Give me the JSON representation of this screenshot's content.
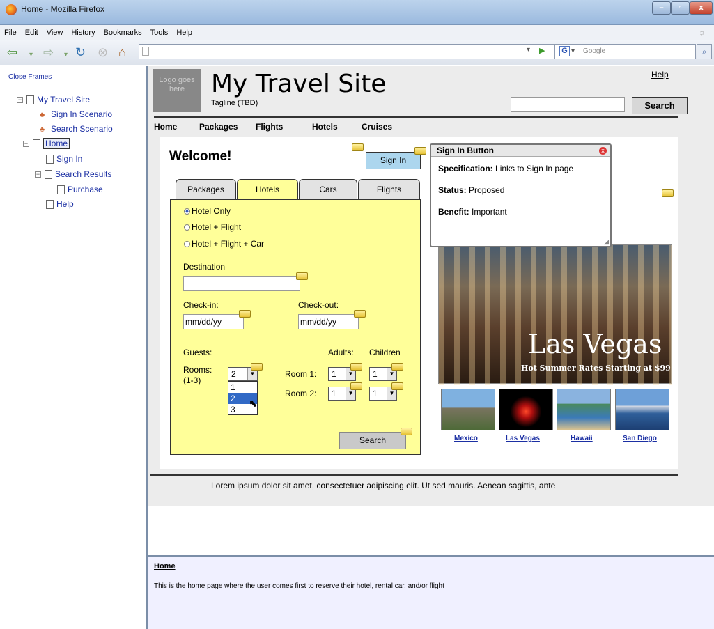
{
  "window": {
    "title": "Home - Mozilla Firefox"
  },
  "menu": [
    "File",
    "Edit",
    "View",
    "History",
    "Bookmarks",
    "Tools",
    "Help"
  ],
  "toolbar": {
    "search_placeholder": "Google"
  },
  "sidebar": {
    "close_frames": "Close Frames",
    "tree": [
      {
        "label": "My Travel Site",
        "type": "page",
        "toggle": "⊟"
      },
      {
        "label": "Sign In Scenario",
        "type": "scenario"
      },
      {
        "label": "Search Scenario",
        "type": "scenario"
      },
      {
        "label": "Home",
        "type": "page",
        "toggle": "⊟",
        "selected": true
      },
      {
        "label": "Sign In",
        "type": "page"
      },
      {
        "label": "Search Results",
        "type": "page",
        "toggle": "⊟"
      },
      {
        "label": "Purchase",
        "type": "page"
      },
      {
        "label": "Help",
        "type": "page"
      }
    ]
  },
  "header": {
    "logo": "Logo goes here",
    "site_title": "My Travel Site",
    "tagline": "Tagline (TBD)",
    "help": "Help",
    "search_button": "Search"
  },
  "nav": [
    "Home",
    "Packages",
    "Flights",
    "Hotels",
    "Cruises"
  ],
  "welcome": "Welcome!",
  "sign_in": "Sign In",
  "tabs": [
    "Packages",
    "Hotels",
    "Cars",
    "Flights"
  ],
  "active_tab": "Hotels",
  "booking": {
    "options": [
      "Hotel Only",
      "Hotel + Flight",
      "Hotel + Flight + Car"
    ],
    "selected_option": "Hotel Only",
    "destination_label": "Destination",
    "checkin_label": "Check-in:",
    "checkout_label": "Check-out:",
    "date_value": "mm/dd/yy",
    "guests_label": "Guests:",
    "adults_label": "Adults:",
    "children_label": "Children",
    "rooms_label": "Rooms:",
    "rooms_range": "(1-3)",
    "rooms_value": "2",
    "rooms_options": [
      "1",
      "2",
      "3"
    ],
    "room1_label": "Room 1:",
    "room2_label": "Room 2:",
    "adults_value": "1",
    "children_value": "1",
    "search_button": "Search"
  },
  "popup": {
    "title": "Sign In Button",
    "specification_label": "Specification:",
    "specification": "Links to Sign In page",
    "status_label": "Status:",
    "status": "Proposed",
    "benefit_label": "Benefit:",
    "benefit": "Important"
  },
  "promo": {
    "title": "Las Vegas",
    "subtitle": "Hot Summer Rates Starting at $99!",
    "destinations": [
      "Mexico",
      "Las Vegas",
      "Hawaii",
      "San Diego"
    ]
  },
  "footer_text": "Lorem ipsum dolor sit amet, consectetuer adipiscing elit. Ut sed mauris. Aenean sagittis, ante",
  "bottom": {
    "heading": "Home",
    "description": "This is the home page where the user comes first to reserve their hotel, rental car, and/or flight"
  }
}
